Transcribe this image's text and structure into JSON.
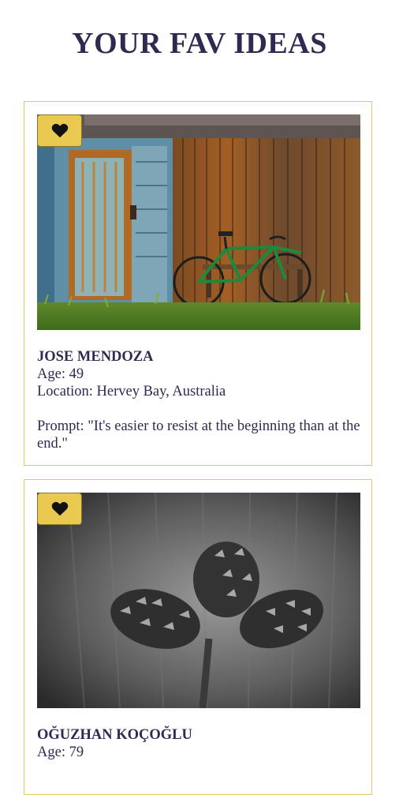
{
  "page": {
    "title": "YOUR FAV IDEAS"
  },
  "colors": {
    "title_text": "#2e2a52",
    "card_border": "#e8c85a",
    "fav_button_bg": "#e9c950"
  },
  "ideas": [
    {
      "name": "JOSE MENDOZA",
      "age": "Age: 49",
      "location": "Location: Hervey Bay, Australia",
      "prompt": "Prompt: \"It's easier to resist at the beginning than at the end.\"",
      "photo_icon": "photo-wooden-shed-bicycle",
      "fav_icon": "heart-icon"
    },
    {
      "name": "OĞUZHAN KOÇOĞLU",
      "age": "Age: 79",
      "photo_icon": "photo-pinecones",
      "fav_icon": "heart-icon"
    }
  ]
}
